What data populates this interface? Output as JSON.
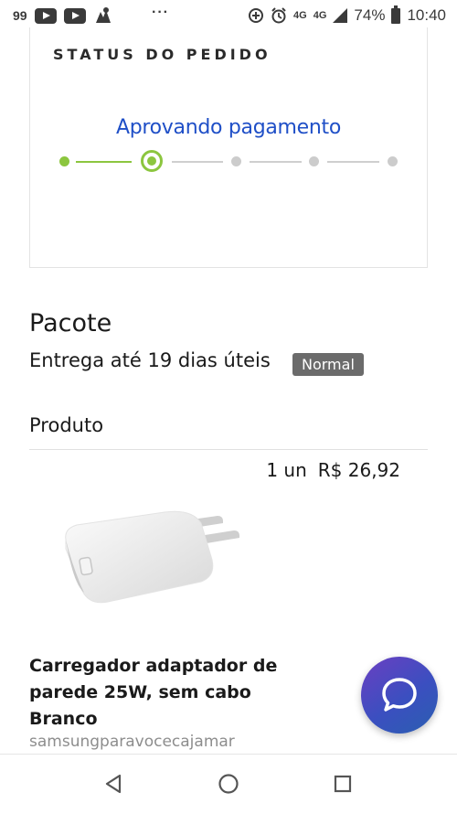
{
  "status_bar": {
    "notif_count": "99",
    "overflow": "···",
    "network_small": "4G",
    "network": "4G",
    "battery": "74%",
    "time": "10:40"
  },
  "order_status": {
    "title": "STATUS DO PEDIDO",
    "current_step": "Aprovando pagamento",
    "total_steps": 5,
    "completed_steps": 1,
    "current_step_index": 2,
    "accent_color": "#8cc63f",
    "current_text_color": "#1f4fc7"
  },
  "package": {
    "title": "Pacote",
    "delivery": "Entrega até 19 dias úteis",
    "badge": "Normal"
  },
  "product": {
    "section_label": "Produto",
    "quantity": "1 un",
    "price": "R$ 26,92",
    "name": "Carregador adaptador de parede 25W, sem cabo Branco",
    "seller": "samsungparavocecajamar"
  },
  "chat_button": {
    "icon": "chat-bubble-icon"
  },
  "nav": {
    "back": "back-icon",
    "home": "home-icon",
    "recents": "recents-icon"
  }
}
